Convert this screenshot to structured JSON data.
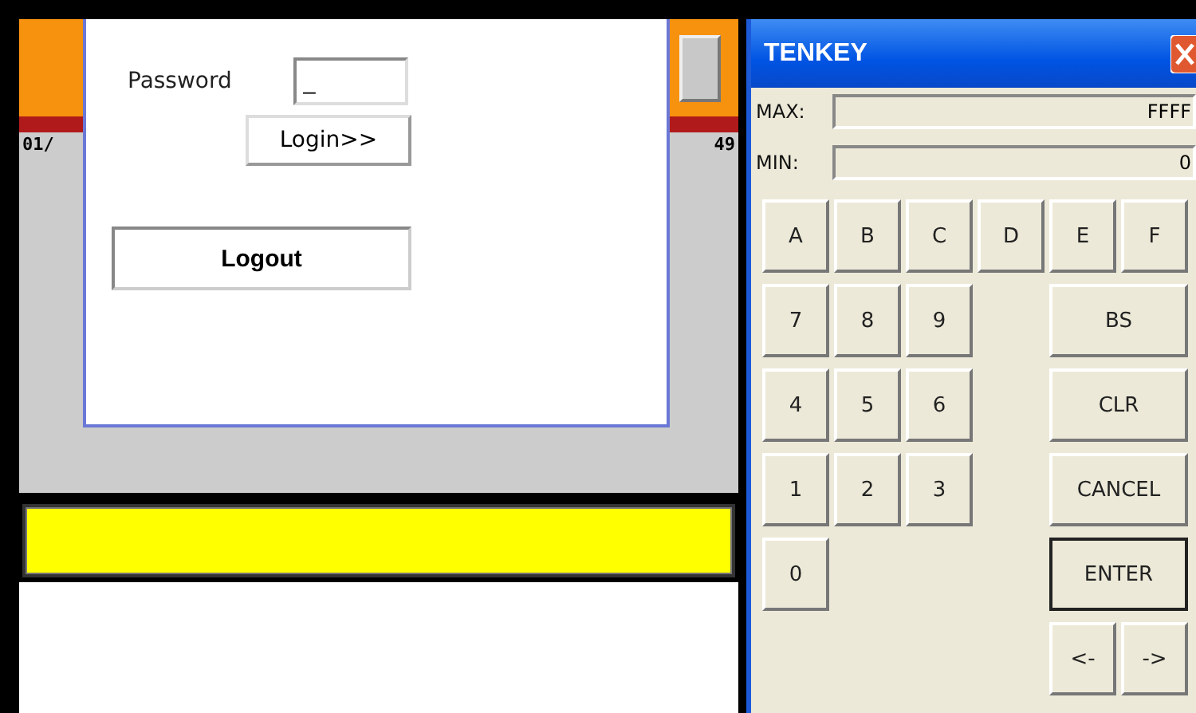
{
  "background_app": {
    "date_fragment": "01/",
    "number": "49"
  },
  "login_dialog": {
    "password_label": "Password",
    "password_value": "_",
    "login_button": "Login>>",
    "logout_button": "Logout"
  },
  "tenkey": {
    "title": "TENKEY",
    "max_label": "MAX:",
    "max_value": "FFFF",
    "min_label": "MIN:",
    "min_value": "0",
    "keys": [
      {
        "label": "A",
        "default": false
      },
      {
        "label": "B",
        "default": false
      },
      {
        "label": "C",
        "default": false
      },
      {
        "label": "D",
        "default": false
      },
      {
        "label": "E",
        "default": false
      },
      {
        "label": "F",
        "default": false
      },
      {
        "label": "7",
        "default": false
      },
      {
        "label": "8",
        "default": false
      },
      {
        "label": "9",
        "default": false
      },
      {
        "label": "BS",
        "default": false
      },
      {
        "label": "4",
        "default": false
      },
      {
        "label": "5",
        "default": false
      },
      {
        "label": "6",
        "default": false
      },
      {
        "label": "CLR",
        "default": false
      },
      {
        "label": "1",
        "default": false
      },
      {
        "label": "2",
        "default": false
      },
      {
        "label": "3",
        "default": false
      },
      {
        "label": "CANCEL",
        "default": false
      },
      {
        "label": "0",
        "default": false
      },
      {
        "label": "ENTER",
        "default": true
      },
      {
        "label": "<-",
        "default": false
      },
      {
        "label": "->",
        "default": false
      }
    ]
  }
}
